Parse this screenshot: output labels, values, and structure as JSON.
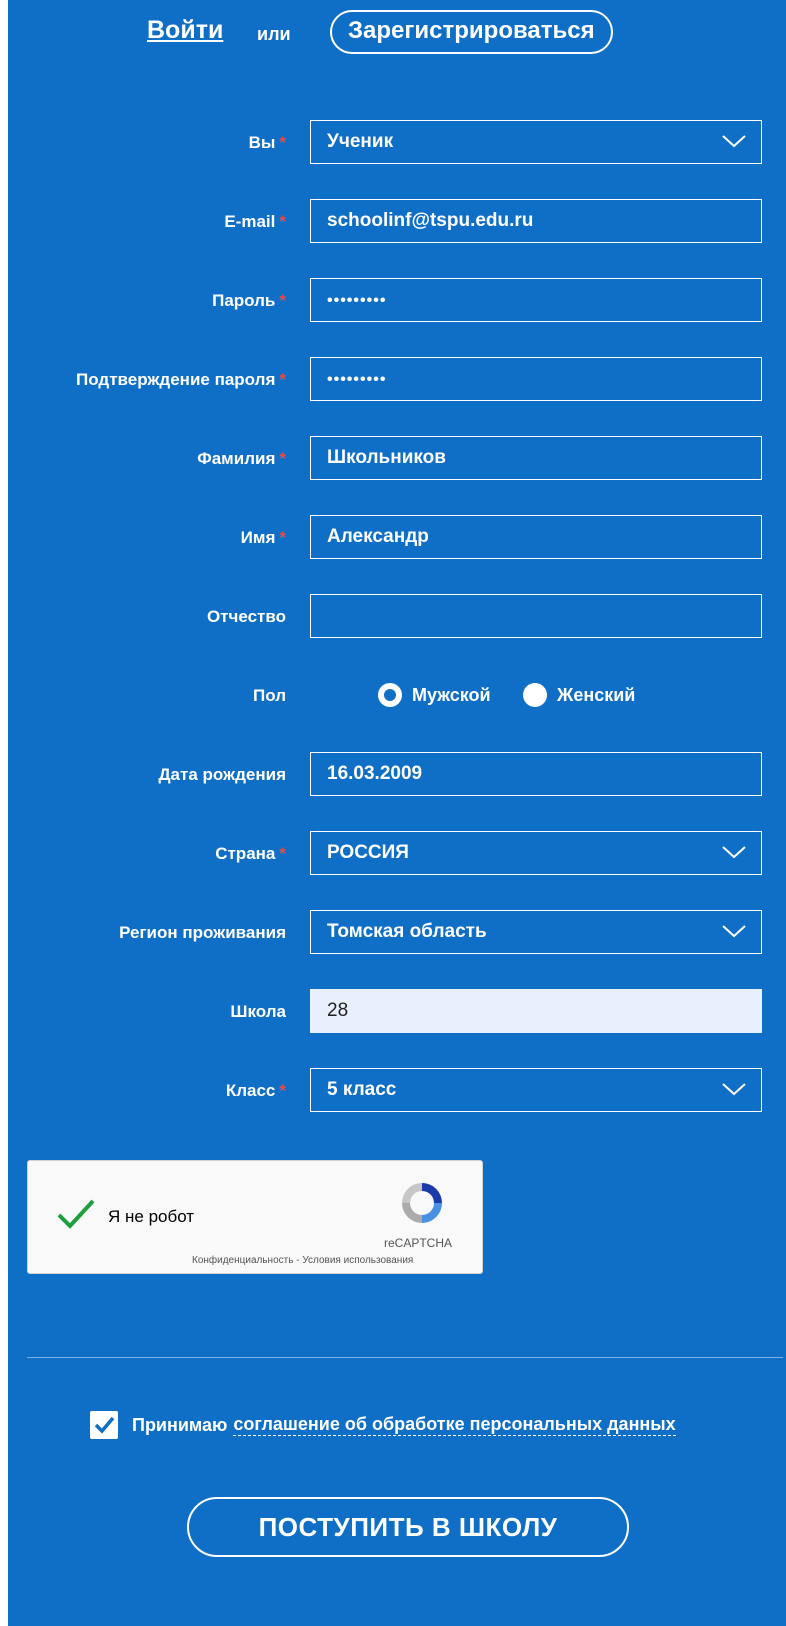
{
  "nav": {
    "login": "Войти",
    "or": "или",
    "register": "Зарегистрироваться"
  },
  "form": {
    "role": {
      "label": "Вы",
      "value": "Ученик"
    },
    "email": {
      "label": "E-mail",
      "value": "schoolinf@tspu.edu.ru"
    },
    "password": {
      "label": "Пароль",
      "value": "•••••••••"
    },
    "password_confirm": {
      "label": "Подтверждение пароля",
      "value": "•••••••••"
    },
    "last_name": {
      "label": "Фамилия",
      "value": "Школьников"
    },
    "first_name": {
      "label": "Имя",
      "value": "Александр"
    },
    "patronymic": {
      "label": "Отчество",
      "value": ""
    },
    "gender": {
      "label": "Пол",
      "options": [
        "Мужской",
        "Женский"
      ],
      "selected": "Мужской"
    },
    "birth_date": {
      "label": "Дата рождения",
      "value": "16.03.2009"
    },
    "country": {
      "label": "Страна",
      "value": "РОССИЯ"
    },
    "region": {
      "label": "Регион проживания",
      "value": "Томская область"
    },
    "school": {
      "label": "Школа",
      "value": "28"
    },
    "grade": {
      "label": "Класс",
      "value": "5 класс"
    },
    "required_mark": "*"
  },
  "captcha": {
    "label": "Я не робот",
    "brand": "reCAPTCHA",
    "links": "Конфиденциальность - Условия использования",
    "checked": true
  },
  "agreement": {
    "text": "Принимаю",
    "link": "соглашение об обработке персональных данных",
    "checked": true
  },
  "submit": {
    "label": "ПОСТУПИТЬ В ШКОЛУ"
  },
  "colors": {
    "background": "#0f6fc6",
    "required": "#e84a4a",
    "captcha_check": "#1e9f3e"
  }
}
